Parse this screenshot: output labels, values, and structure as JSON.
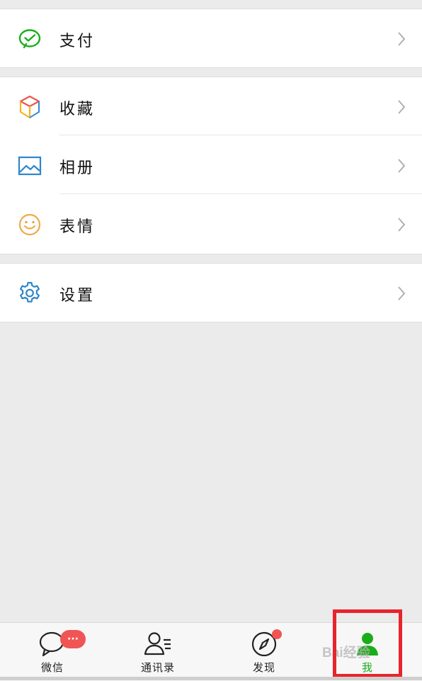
{
  "menu": {
    "pay": {
      "label": "支付",
      "icon": "wechat-pay-icon"
    },
    "favorites": {
      "label": "收藏",
      "icon": "cube-icon"
    },
    "album": {
      "label": "相册",
      "icon": "picture-icon"
    },
    "stickers": {
      "label": "表情",
      "icon": "smiley-icon"
    },
    "settings": {
      "label": "设置",
      "icon": "gear-icon"
    }
  },
  "tabbar": {
    "chats": {
      "label": "微信",
      "badge": "···"
    },
    "contacts": {
      "label": "通讯录"
    },
    "discover": {
      "label": "发现",
      "has_dot": true
    },
    "me": {
      "label": "我",
      "active": true
    }
  },
  "watermark": "Bai经验",
  "colors": {
    "accent": "#1aad19",
    "badge": "#f15454",
    "highlight": "#e8242c"
  }
}
